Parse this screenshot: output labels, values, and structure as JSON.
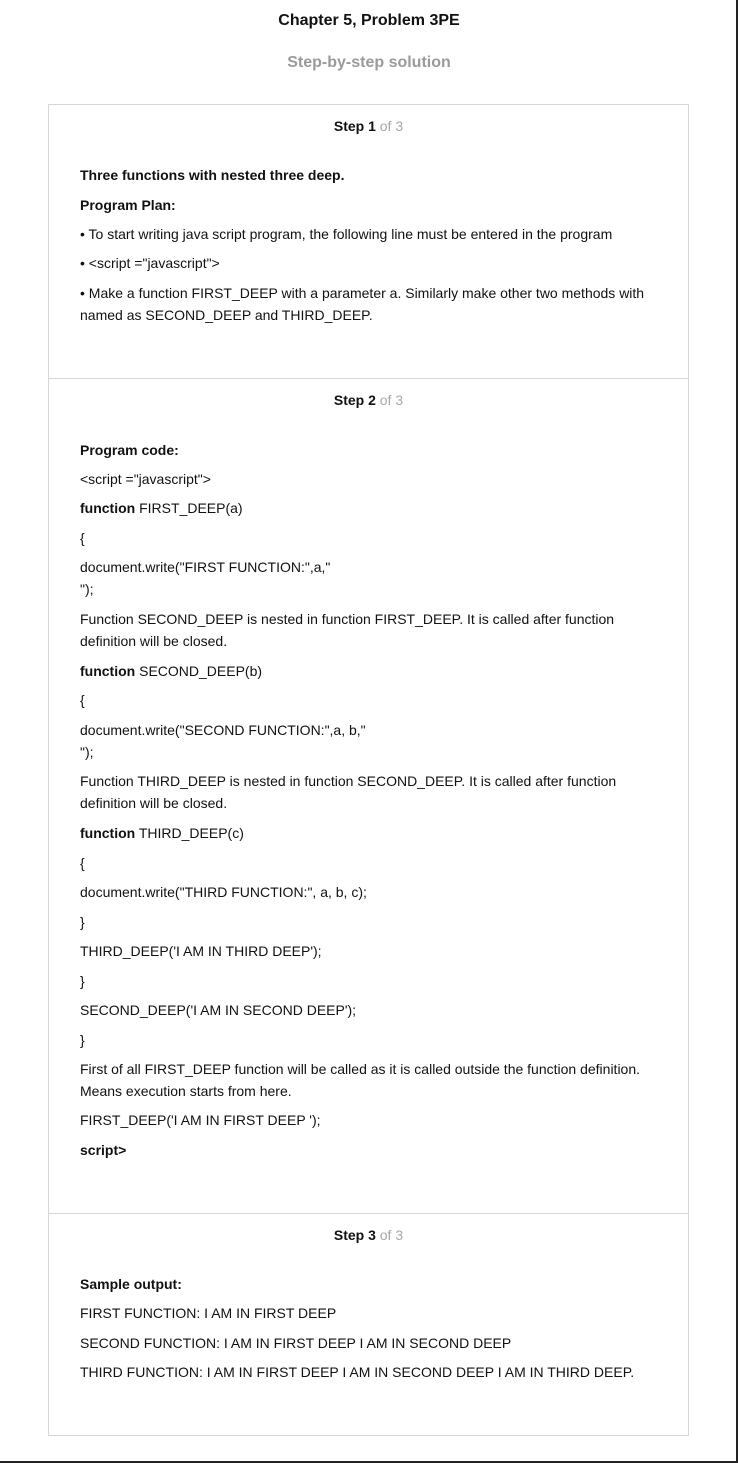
{
  "header": {
    "title": "Chapter 5, Problem 3PE",
    "subtitle": "Step-by-step solution"
  },
  "steps": [
    {
      "label": "Step 1",
      "of": " of 3",
      "lines": [
        "Three functions with nested three deep.",
        "Program Plan:",
        "• To start writing java script program, the following line must be entered in the program",
        "• <script =\"javascript\">",
        "• Make a function FIRST_DEEP with a parameter a. Similarly make other two methods with named as SECOND_DEEP and THIRD_DEEP."
      ]
    },
    {
      "label": "Step 2",
      "of": " of 3",
      "lines": [
        "Program code:",
        "<script =\"javascript\">",
        "function",
        " FIRST_DEEP(a)",
        "{",
        "document.write(\"FIRST FUNCTION:\",a,\"\n\");",
        "Function SECOND_DEEP is nested in function FIRST_DEEP. It is called after function definition will be closed.",
        "function",
        " SECOND_DEEP(b)",
        "{",
        "document.write(\"SECOND FUNCTION:\",a, b,\"\n\");",
        "Function THIRD_DEEP is nested in function SECOND_DEEP. It is called after function definition will be closed.",
        "function",
        " THIRD_DEEP(c)",
        "{",
        "document.write(\"THIRD FUNCTION:\", a, b, c);",
        "}",
        "THIRD_DEEP('I AM IN THIRD DEEP');",
        "}",
        "SECOND_DEEP('I AM IN SECOND DEEP');",
        "}",
        "First of all FIRST_DEEP function will be called as it is called outside the function definition. Means execution starts from here.",
        "FIRST_DEEP('I AM IN FIRST DEEP ');",
        "script>"
      ]
    },
    {
      "label": "Step 3",
      "of": " of 3",
      "lines": [
        "Sample output:",
        "FIRST FUNCTION: I AM IN FIRST DEEP",
        "SECOND FUNCTION: I AM IN FIRST DEEP I AM IN SECOND DEEP",
        "THIRD FUNCTION: I AM IN FIRST DEEP I AM IN SECOND DEEP I AM IN THIRD DEEP."
      ]
    }
  ]
}
